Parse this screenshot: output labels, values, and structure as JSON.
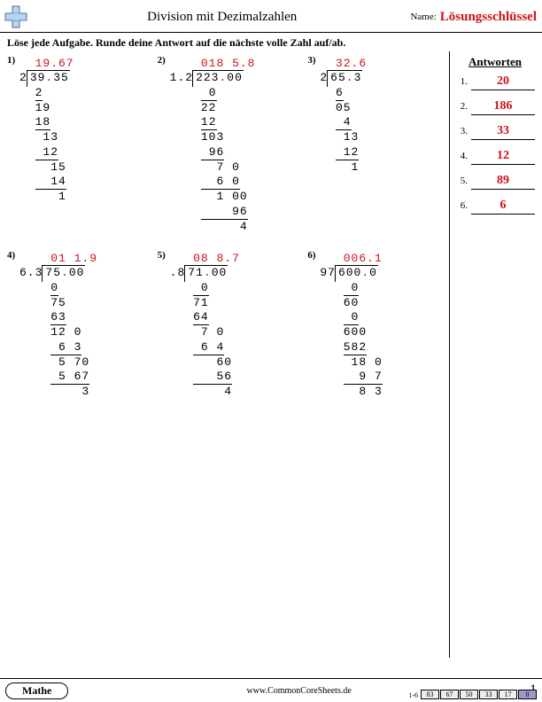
{
  "header": {
    "title": "Division mit Dezimalzahlen",
    "name_label": "Name:",
    "answer_key": "Lösungsschlüssel"
  },
  "instruction": "Löse jede Aufgabe. Runde deine Antwort auf die nächste volle Zahl auf/ab.",
  "answers_heading": "Antworten",
  "footer": {
    "subject": "Mathe",
    "site": "www.CommonCoreSheets.de",
    "page": "1",
    "meter_label": "1-6",
    "meter": [
      "83",
      "67",
      "50",
      "33",
      "17",
      "0"
    ]
  },
  "answers": [
    "20",
    "186",
    "33",
    "12",
    "89",
    "6"
  ],
  "problems": [
    {
      "n": "1)",
      "divisor": "2",
      "dividend": "39.35",
      "quotient": "19.67",
      "steps": [
        [
          "2",
          true
        ],
        [
          "19",
          false
        ],
        [
          "18",
          true
        ],
        [
          " 13",
          false
        ],
        [
          " 12",
          true
        ],
        [
          "  15",
          false
        ],
        [
          "  14",
          true
        ],
        [
          "   1",
          false
        ]
      ]
    },
    {
      "n": "2)",
      "divisor": "1.2",
      "dividend": "223.00",
      "quotient": "018 5.8",
      "steps": [
        [
          " 0",
          true
        ],
        [
          "22",
          false
        ],
        [
          "12",
          true
        ],
        [
          "103",
          false
        ],
        [
          " 96",
          true
        ],
        [
          "  7 0",
          false
        ],
        [
          "  6 0",
          true
        ],
        [
          "  1 00",
          false
        ],
        [
          "    96",
          true
        ],
        [
          "     4",
          false
        ]
      ]
    },
    {
      "n": "3)",
      "divisor": "2",
      "dividend": "65.3",
      "quotient": "32.6",
      "steps": [
        [
          "6",
          true
        ],
        [
          "05",
          false
        ],
        [
          " 4",
          true
        ],
        [
          " 13",
          false
        ],
        [
          " 12",
          true
        ],
        [
          "  1",
          false
        ]
      ]
    },
    {
      "n": "4)",
      "divisor": "6.3",
      "dividend": "75.00",
      "quotient": "01 1.9",
      "steps": [
        [
          "0",
          true
        ],
        [
          "75",
          false
        ],
        [
          "63",
          true
        ],
        [
          "12 0",
          false
        ],
        [
          " 6 3",
          true
        ],
        [
          " 5 70",
          false
        ],
        [
          " 5 67",
          true
        ],
        [
          "    3",
          false
        ]
      ]
    },
    {
      "n": "5)",
      "divisor": ".8",
      "dividend": "71.00",
      "quotient": "08 8.7",
      "steps": [
        [
          " 0",
          true
        ],
        [
          "71",
          false
        ],
        [
          "64",
          true
        ],
        [
          " 7 0",
          false
        ],
        [
          " 6 4",
          true
        ],
        [
          "   60",
          false
        ],
        [
          "   56",
          true
        ],
        [
          "    4",
          false
        ]
      ]
    },
    {
      "n": "6)",
      "divisor": "97",
      "dividend": "600.0",
      "quotient": "006.1",
      "steps": [
        [
          " 0",
          true
        ],
        [
          "60",
          false
        ],
        [
          " 0",
          true
        ],
        [
          "600",
          false
        ],
        [
          "582",
          true
        ],
        [
          " 18 0",
          false
        ],
        [
          "  9 7",
          true
        ],
        [
          "  8 3",
          false
        ]
      ]
    }
  ]
}
